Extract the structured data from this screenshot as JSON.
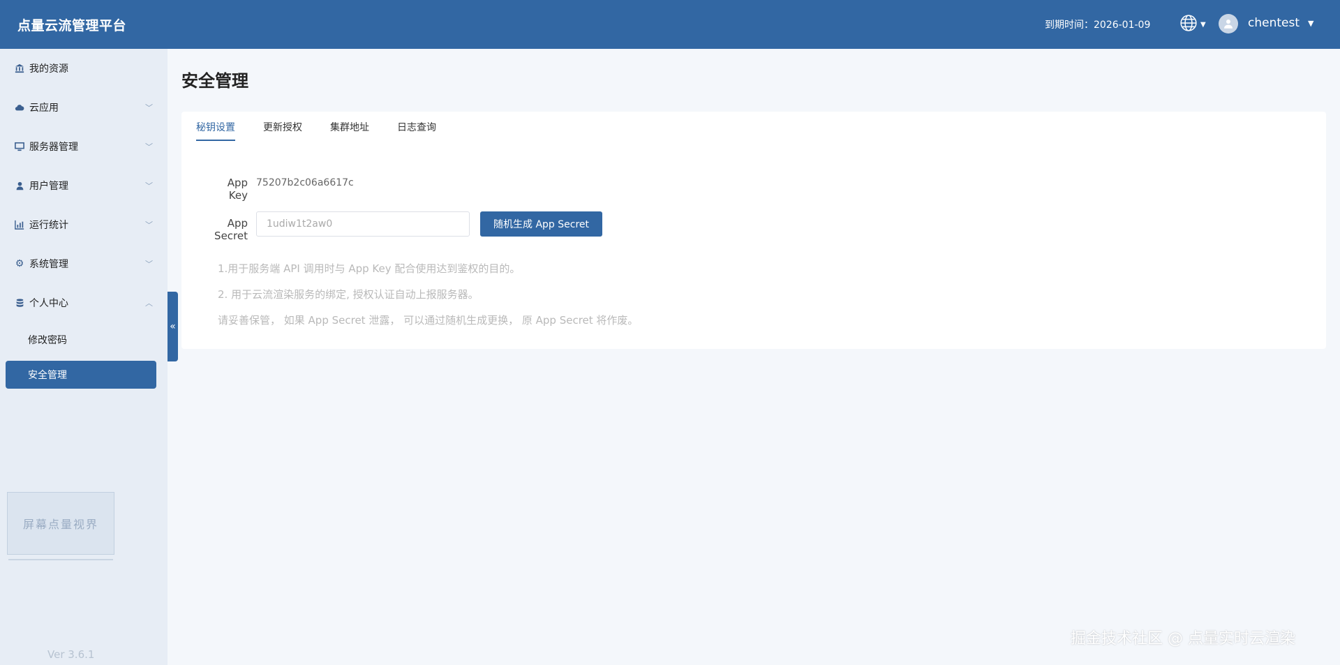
{
  "header": {
    "brand": "点量云流管理平台",
    "expire_label": "到期时间：2026-01-09",
    "username": "chentest"
  },
  "sidebar": {
    "items": [
      {
        "label": "我的资源",
        "icon": "bank-icon"
      },
      {
        "label": "云应用",
        "icon": "cloud-icon"
      },
      {
        "label": "服务器管理",
        "icon": "monitor-icon"
      },
      {
        "label": "用户管理",
        "icon": "user-icon"
      },
      {
        "label": "运行统计",
        "icon": "bar-chart-icon"
      },
      {
        "label": "系统管理",
        "icon": "gear-icon"
      },
      {
        "label": "个人中心",
        "icon": "database-icon"
      }
    ],
    "sub_items": [
      {
        "label": "修改密码"
      },
      {
        "label": "安全管理"
      }
    ],
    "promo_text": "屏幕点量视界",
    "version": "Ver 3.6.1"
  },
  "main": {
    "title": "安全管理",
    "tabs": [
      "秘钥设置",
      "更新授权",
      "集群地址",
      "日志查询"
    ],
    "app_key_label": "App Key",
    "app_key_value": "75207b2c06a6617c",
    "app_secret_label": "App Secret",
    "app_secret_value": "1udiw1t2aw0",
    "generate_button": "随机生成 App Secret",
    "notes": [
      "1.用于服务端 API 调用时与 App Key 配合使用达到鉴权的目的。",
      "2. 用于云流渲染服务的绑定, 授权认证自动上报服务器。",
      "请妥善保管， 如果 App Secret 泄露， 可以通过随机生成更换， 原 App Secret 将作废。"
    ]
  },
  "watermark": "掘金技术社区 @ 点量实时云渲染",
  "colors": {
    "primary": "#3267a3",
    "sidebar_bg": "#e7edf5",
    "page_bg": "#f4f7fb"
  }
}
